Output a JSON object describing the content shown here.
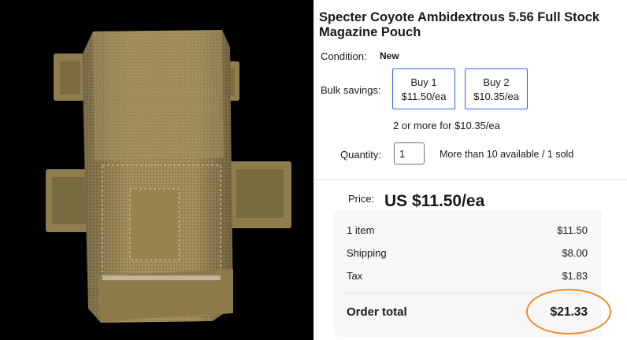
{
  "product": {
    "title": "Specter Coyote Ambidextrous 5.56 Full Stock Magazine Pouch",
    "image_icon": "product-photo-magazine-pouch"
  },
  "condition": {
    "label": "Condition:",
    "value": "New"
  },
  "bulk": {
    "label": "Bulk savings:",
    "options": [
      {
        "line1": "Buy 1",
        "line2": "$11.50/ea"
      },
      {
        "line1": "Buy 2",
        "line2": "$10.35/ea"
      }
    ],
    "note": "2 or more for $10.35/ea"
  },
  "quantity": {
    "label": "Quantity:",
    "value": "1",
    "availability": "More than 10 available / 1 sold"
  },
  "price": {
    "label": "Price:",
    "value": "US $11.50/ea"
  },
  "summary": {
    "rows": [
      {
        "label": "1 item",
        "value": "$11.50"
      },
      {
        "label": "Shipping",
        "value": "$8.00"
      },
      {
        "label": "Tax",
        "value": "$1.83"
      }
    ],
    "total_label": "Order total",
    "total_value": "$21.33"
  },
  "colors": {
    "accent": "#3665f3",
    "highlight_circle": "#f08a2c",
    "summary_bg": "#f7f7f7",
    "pouch": "#a08d5a"
  }
}
